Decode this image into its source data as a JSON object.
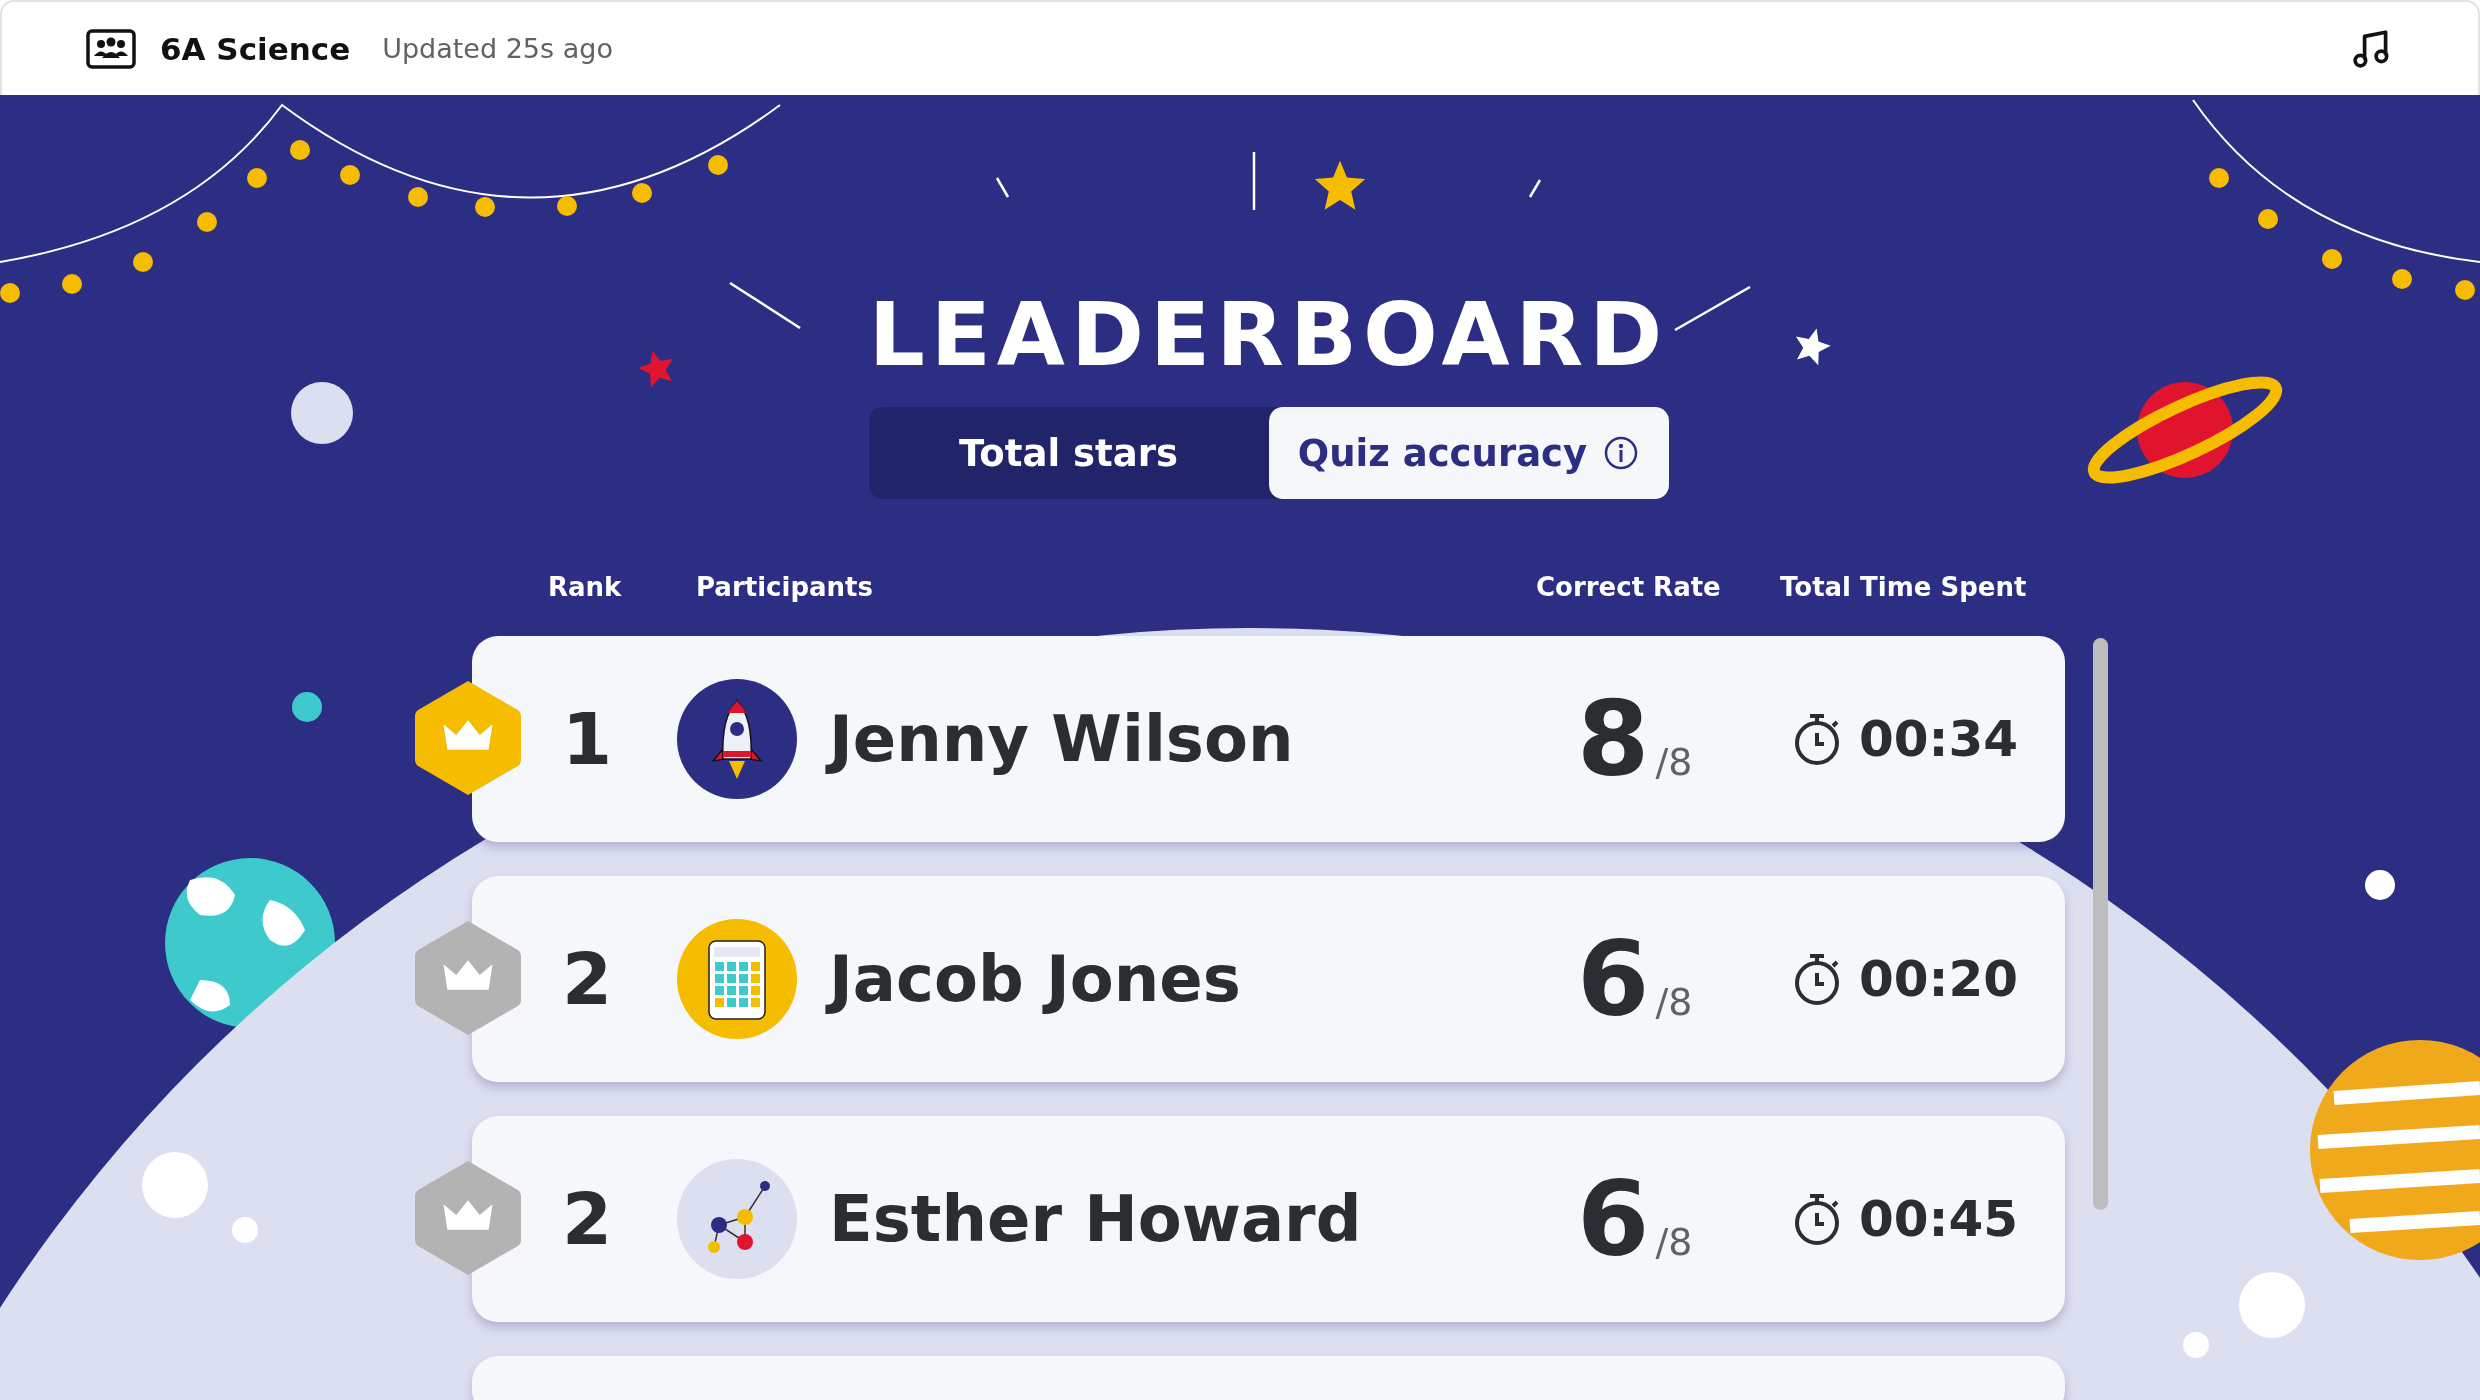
{
  "header": {
    "class_name": "6A Science",
    "updated": "Updated 25s ago"
  },
  "title": "LEADERBOARD",
  "tabs": [
    {
      "label": "Total stars",
      "selected": false,
      "info_icon": false
    },
    {
      "label": "Quiz accuracy",
      "selected": true,
      "info_icon": true
    }
  ],
  "columns": [
    "Rank",
    "Participants",
    "Correct Rate",
    "Total Time Spent"
  ],
  "rows": [
    {
      "rank": "1",
      "name": "Jenny Wilson",
      "score": "8",
      "out_of": "/8",
      "time": "00:34",
      "color": "#f5bc00"
    },
    {
      "rank": "2",
      "name": "Jacob Jones",
      "score": "6",
      "out_of": "/8",
      "time": "00:20",
      "color": "#b3b3b3"
    },
    {
      "rank": "2",
      "name": "Esther Howard",
      "score": "6",
      "out_of": "/8",
      "time": "00:45",
      "color": "#b3b3b3"
    }
  ]
}
